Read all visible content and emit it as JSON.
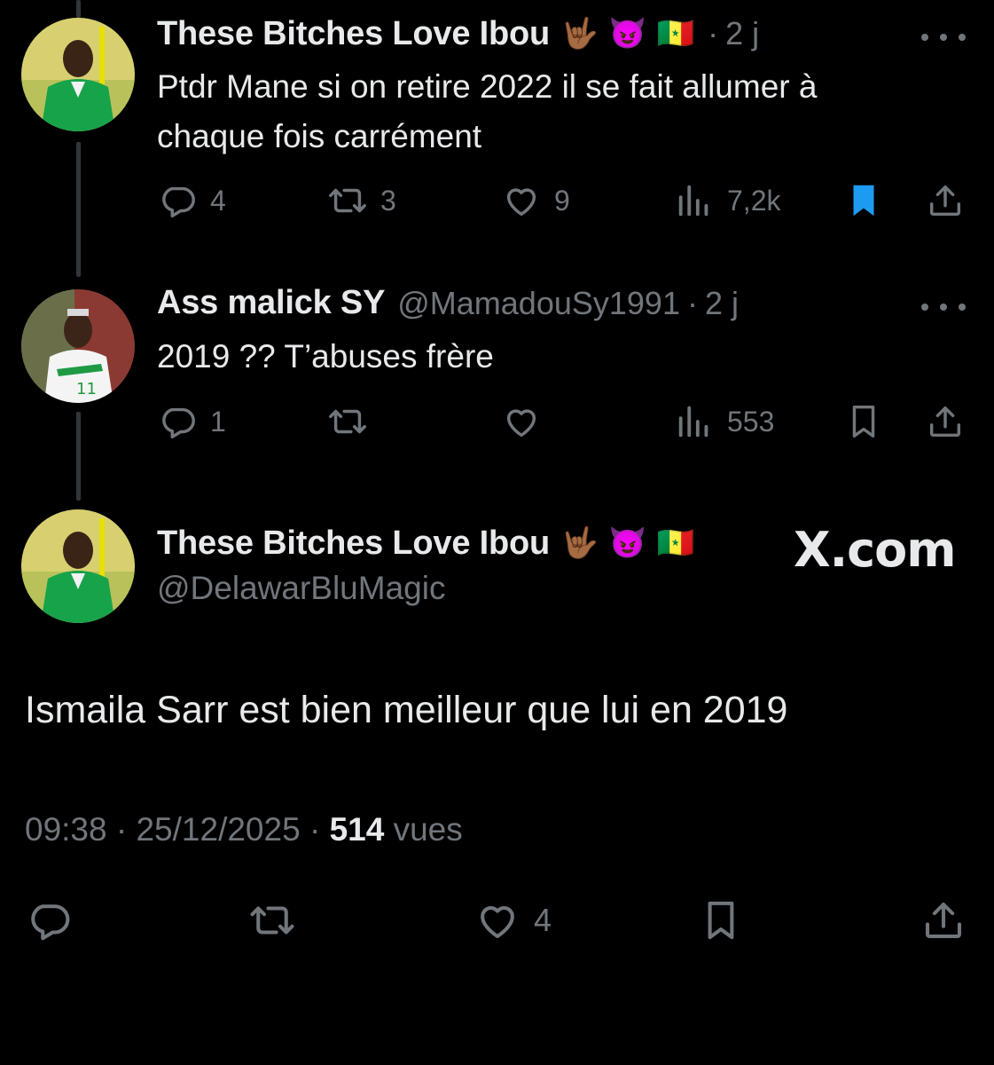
{
  "colors": {
    "background": "#000000",
    "text": "#e7e9ea",
    "muted": "#71767b",
    "bookmark_active": "#1d9bf0"
  },
  "tweets": [
    {
      "name": "These Bitches Love Ibou",
      "emojis": [
        "🤟🏾",
        "😈",
        "🇸🇳"
      ],
      "sep": "·",
      "time": "2 j",
      "text_line1": "Ptdr Mane si on retire 2022 il se fait allumer à",
      "text_line2": "chaque fois carrément",
      "replies": "4",
      "reposts": "3",
      "likes": "9",
      "views": "7,2k",
      "bookmarked": true,
      "icons": [
        "reply-icon",
        "repost-icon",
        "like-icon",
        "views-icon",
        "bookmark-icon",
        "share-icon"
      ]
    },
    {
      "name": "Ass malick SY",
      "handle": "@MamadouSy1991",
      "sep": "·",
      "time": "2 j",
      "text": "2019 ?? T’abuses frère",
      "replies": "1",
      "views": "553",
      "bookmarked": false
    }
  ],
  "main": {
    "name": "These Bitches Love Ibou",
    "emojis": [
      "🤟🏾",
      "😈",
      "🇸🇳"
    ],
    "handle": "@DelawarBluMagic",
    "watermark": "X.com",
    "text": "Ismaila Sarr est bien meilleur que lui en 2019",
    "time": "09:38",
    "sep": "·",
    "date": "25/12/2025",
    "views_count": "514",
    "views_label": "vues",
    "likes": "4"
  }
}
